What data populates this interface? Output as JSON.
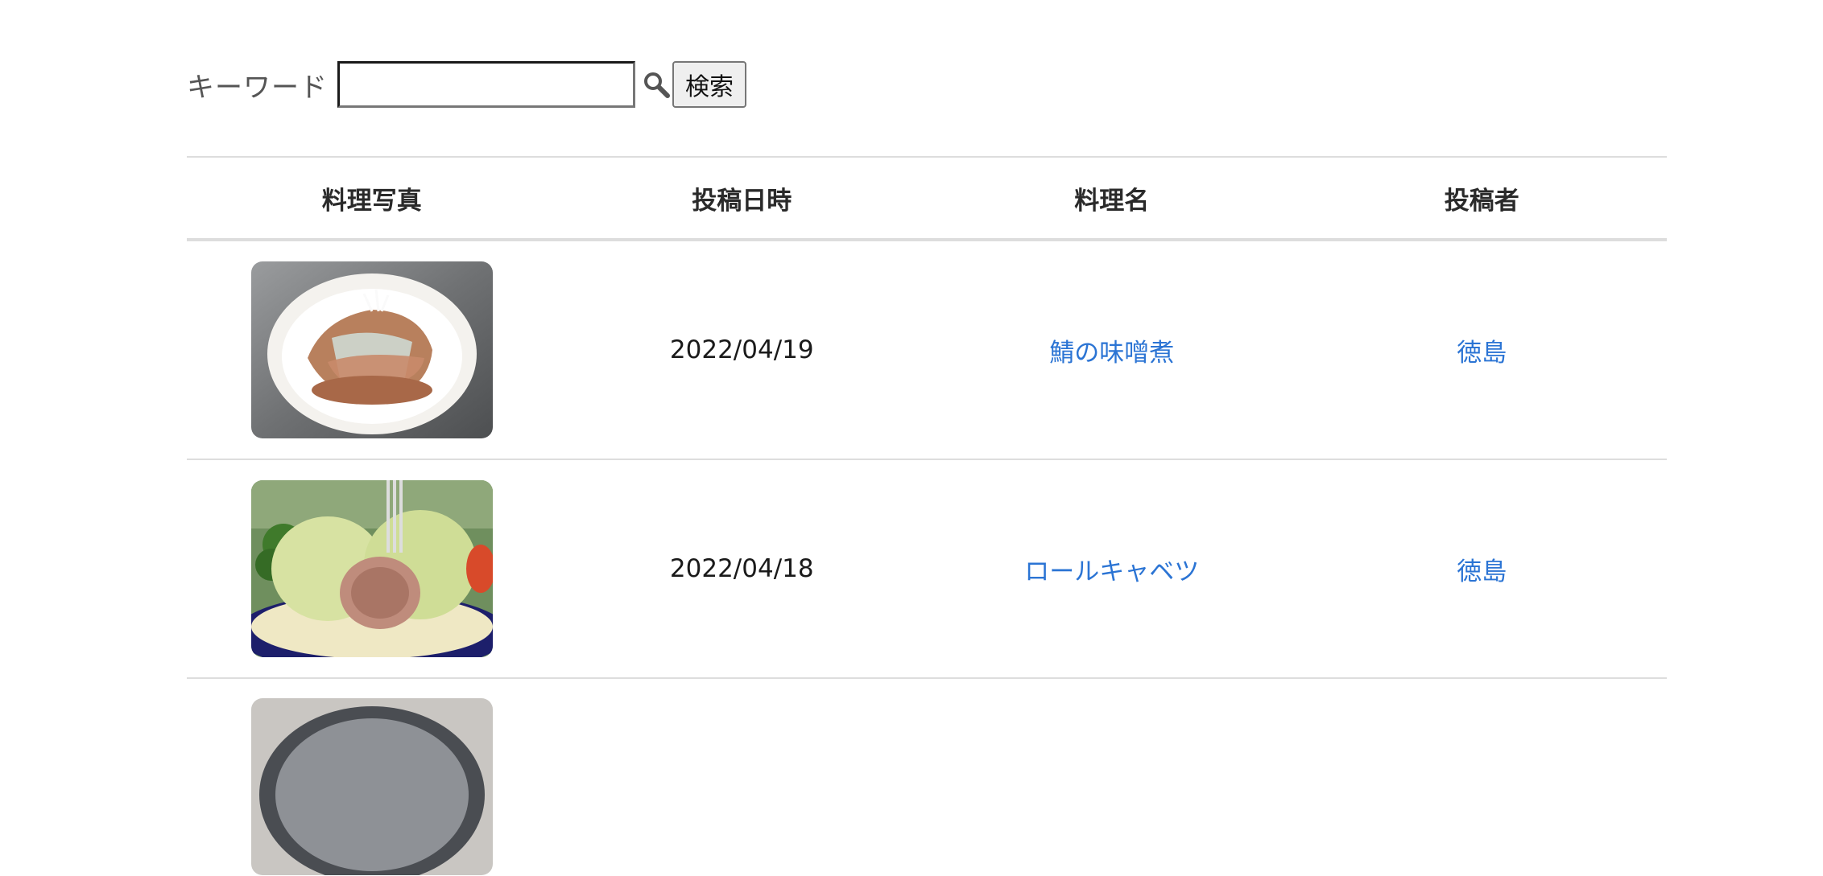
{
  "search": {
    "label": "キーワード",
    "value": "",
    "placeholder": "",
    "button_label": "検索"
  },
  "table": {
    "headers": {
      "photo": "料理写真",
      "date": "投稿日時",
      "dish": "料理名",
      "author": "投稿者"
    },
    "rows": [
      {
        "photo": "saba-misoni-photo",
        "date": "2022/04/19",
        "dish": "鯖の味噌煮",
        "author": "徳島"
      },
      {
        "photo": "roll-cabbage-photo",
        "date": "2022/04/18",
        "dish": "ロールキャベツ",
        "author": "徳島"
      }
    ]
  },
  "colors": {
    "link": "#2b74d4",
    "border": "#dddddd"
  }
}
